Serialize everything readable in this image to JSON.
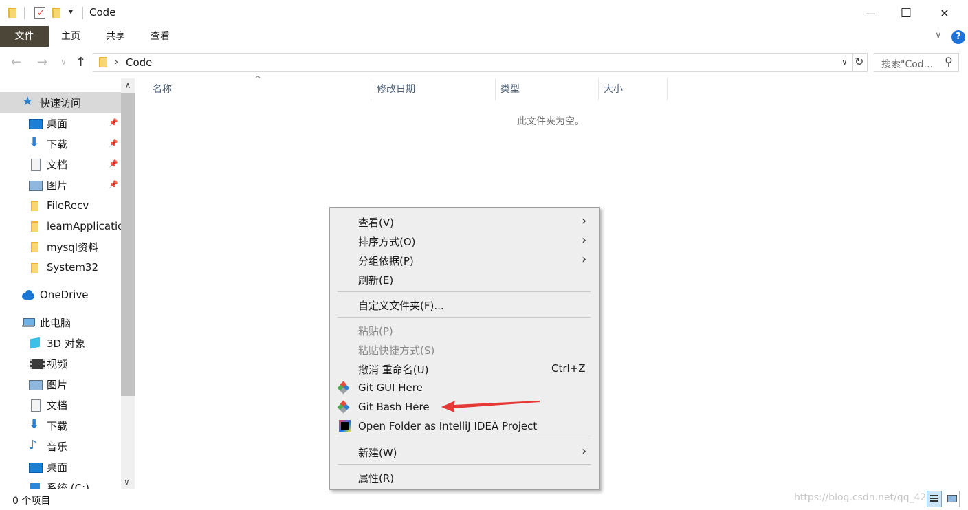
{
  "window": {
    "title": "Code",
    "minimize_glyph": "—",
    "maximize_glyph": "☐",
    "close_glyph": "✕"
  },
  "quick_access_toolbar": {
    "dropdown_glyph": "▾"
  },
  "ribbon": {
    "tabs": [
      "文件",
      "主页",
      "共享",
      "查看"
    ],
    "help_glyph": "?",
    "collapse_glyph": "∨"
  },
  "address_bar": {
    "path": "Code",
    "separator": "›",
    "search_placeholder": "搜索\"Cod...",
    "back_glyph": "←",
    "forward_glyph": "→",
    "recent_glyph": "∨",
    "up_glyph": "↑",
    "dropdown_glyph": "∨",
    "refresh_glyph": "↻",
    "search_glyph": "⚲"
  },
  "nav_pane": {
    "items": [
      {
        "label": "快速访问",
        "icon": "star-icon",
        "level": 0,
        "selected": true
      },
      {
        "label": "桌面",
        "icon": "desktop-icon",
        "level": 1,
        "pinned": true
      },
      {
        "label": "下载",
        "icon": "download-icon",
        "level": 1,
        "pinned": true
      },
      {
        "label": "文档",
        "icon": "document-icon",
        "level": 1,
        "pinned": true
      },
      {
        "label": "图片",
        "icon": "pictures-icon",
        "level": 1,
        "pinned": true
      },
      {
        "label": "FileRecv",
        "icon": "folder-icon",
        "level": 1
      },
      {
        "label": "learnApplicatio",
        "icon": "folder-icon",
        "level": 1
      },
      {
        "label": "mysql资料",
        "icon": "folder-icon",
        "level": 1
      },
      {
        "label": "System32",
        "icon": "folder-icon",
        "level": 1
      },
      {
        "label": "OneDrive",
        "icon": "onedrive-icon",
        "level": 0
      },
      {
        "label": "此电脑",
        "icon": "computer-icon",
        "level": 0
      },
      {
        "label": "3D 对象",
        "icon": "3d-objects-icon",
        "level": 1
      },
      {
        "label": "视频",
        "icon": "video-icon",
        "level": 1
      },
      {
        "label": "图片",
        "icon": "pictures-icon",
        "level": 1
      },
      {
        "label": "文档",
        "icon": "document-icon",
        "level": 1
      },
      {
        "label": "下载",
        "icon": "download-icon",
        "level": 1
      },
      {
        "label": "音乐",
        "icon": "music-icon",
        "level": 1
      },
      {
        "label": "桌面",
        "icon": "desktop-icon",
        "level": 1
      },
      {
        "label": "系统 (C:)",
        "icon": "drive-icon",
        "level": 1
      }
    ],
    "pin_glyph": "📌",
    "scroll_up_glyph": "∧",
    "scroll_down_glyph": "∨"
  },
  "file_list": {
    "columns": [
      "名称",
      "修改日期",
      "类型",
      "大小"
    ],
    "sort_glyph": "^",
    "empty_message": "此文件夹为空。"
  },
  "status_bar": {
    "item_count": "0 个项目",
    "watermark": "https://blog.csdn.net/qq_42"
  },
  "context_menu": {
    "arrow_glyph": "›",
    "items": [
      {
        "label": "查看(V)",
        "submenu": true
      },
      {
        "label": "排序方式(O)",
        "submenu": true
      },
      {
        "label": "分组依据(P)",
        "submenu": true
      },
      {
        "label": "刷新(E)"
      },
      {
        "label": "自定义文件夹(F)..."
      },
      {
        "label": "粘贴(P)",
        "disabled": true
      },
      {
        "label": "粘贴快捷方式(S)",
        "disabled": true
      },
      {
        "label": "撤消 重命名(U)",
        "shortcut": "Ctrl+Z"
      },
      {
        "label": "Git GUI Here",
        "icon": "git-icon"
      },
      {
        "label": "Git Bash Here",
        "icon": "git-icon"
      },
      {
        "label": "Open Folder as IntelliJ IDEA Project",
        "icon": "intellij-icon"
      },
      {
        "label": "新建(W)",
        "submenu": true
      },
      {
        "label": "属性(R)"
      }
    ]
  },
  "colors": {
    "file_tab": "#4b4637",
    "help": "#1f73d8",
    "annotation_arrow": "#e53935",
    "menu_bg": "#eeeeee"
  }
}
